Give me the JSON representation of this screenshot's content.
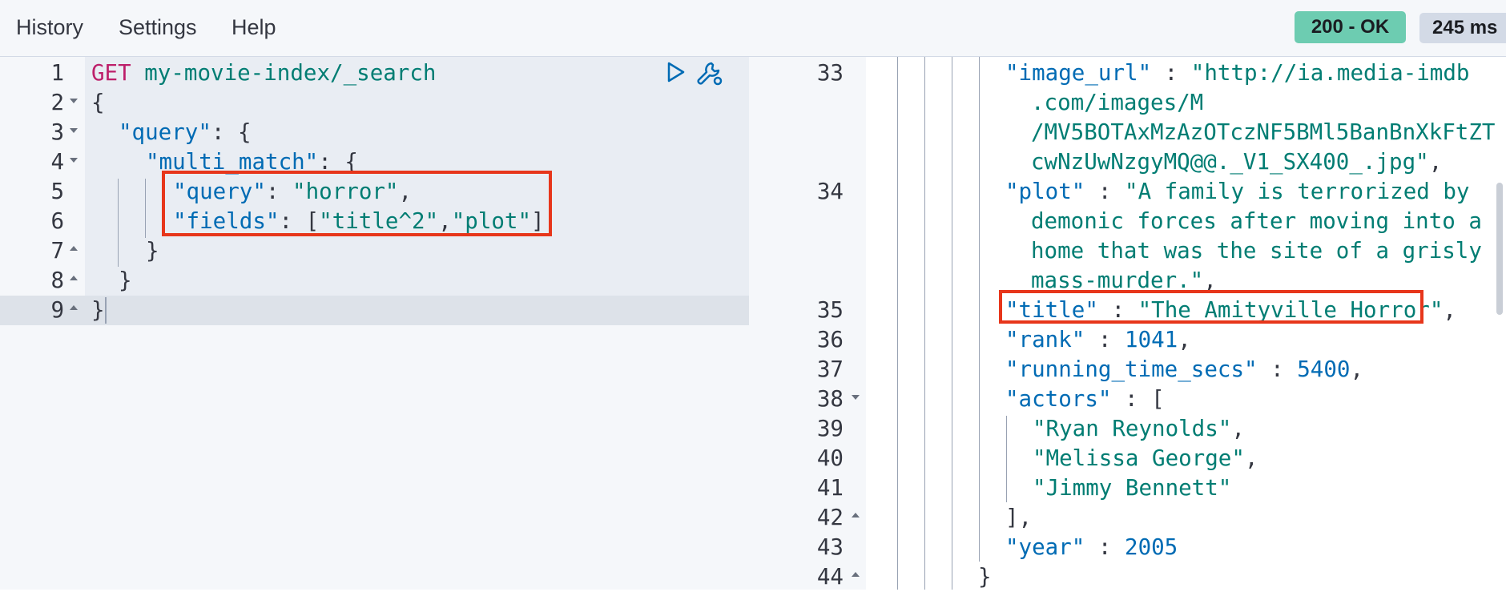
{
  "menu": {
    "history": "History",
    "settings": "Settings",
    "help": "Help"
  },
  "status": {
    "code": "200 - OK",
    "time": "245 ms"
  },
  "colors": {
    "status_ok": "#6dccb1",
    "highlight_box": "#e7361b",
    "key": "#006bb4",
    "string": "#017d73",
    "verb": "#bd1f6a"
  },
  "request": {
    "line_numbers": [
      "1",
      "2",
      "3",
      "4",
      "5",
      "6",
      "7",
      "8",
      "9"
    ],
    "method": "GET",
    "path": "my-movie-index/_search",
    "open_brace": "{",
    "query_key": "\"query\"",
    "query_open": ": {",
    "multi_match_key": "\"multi_match\"",
    "multi_match_open": ": {",
    "inner_query_key": "\"query\"",
    "inner_query_colon": ": ",
    "inner_query_value": "\"horror\"",
    "inner_query_comma": ",",
    "fields_key": "\"fields\"",
    "fields_colon": ": [",
    "field_1": "\"title^2\"",
    "field_sep": ",",
    "field_2": "\"plot\"",
    "fields_close": "]",
    "close_brace_1": "}",
    "close_brace_2": "}",
    "close_brace_3": "}",
    "run_icon": "play-icon",
    "settings_icon": "wrench-icon"
  },
  "response": {
    "line_numbers": [
      "33",
      "34",
      "35",
      "36",
      "37",
      "38",
      "39",
      "40",
      "41",
      "42",
      "43",
      "44"
    ],
    "image_url_key": "\"image_url\"",
    "image_url_line1": "\"http://ia.media-imdb",
    "image_url_line2": ".com/images/M",
    "image_url_line3": "/MV5BOTAxMzAzOTczNF5BMl5BanBnXkFtZT",
    "image_url_line4": "cwNzUwNzgyMQ@@._V1_SX400_.jpg\"",
    "plot_key": "\"plot\"",
    "plot_line1": "\"A family is terrorized by",
    "plot_line2": "demonic forces after moving into a",
    "plot_line3": "home that was the site of a grisly",
    "plot_line4": "mass-murder.\"",
    "title_key": "\"title\"",
    "title_value": "\"The Amityville Horror\"",
    "rank_key": "\"rank\"",
    "rank_value": "1041",
    "running_time_key": "\"running_time_secs\"",
    "running_time_value": "5400",
    "actors_key": "\"actors\"",
    "actors_open": "[",
    "actor_1": "\"Ryan Reynolds\"",
    "actor_2": "\"Melissa George\"",
    "actor_3": "\"Jimmy Bennett\"",
    "actors_close": "],",
    "year_key": "\"year\"",
    "year_value": "2005",
    "close_brace": "}",
    "colon": " : ",
    "comma": ","
  }
}
